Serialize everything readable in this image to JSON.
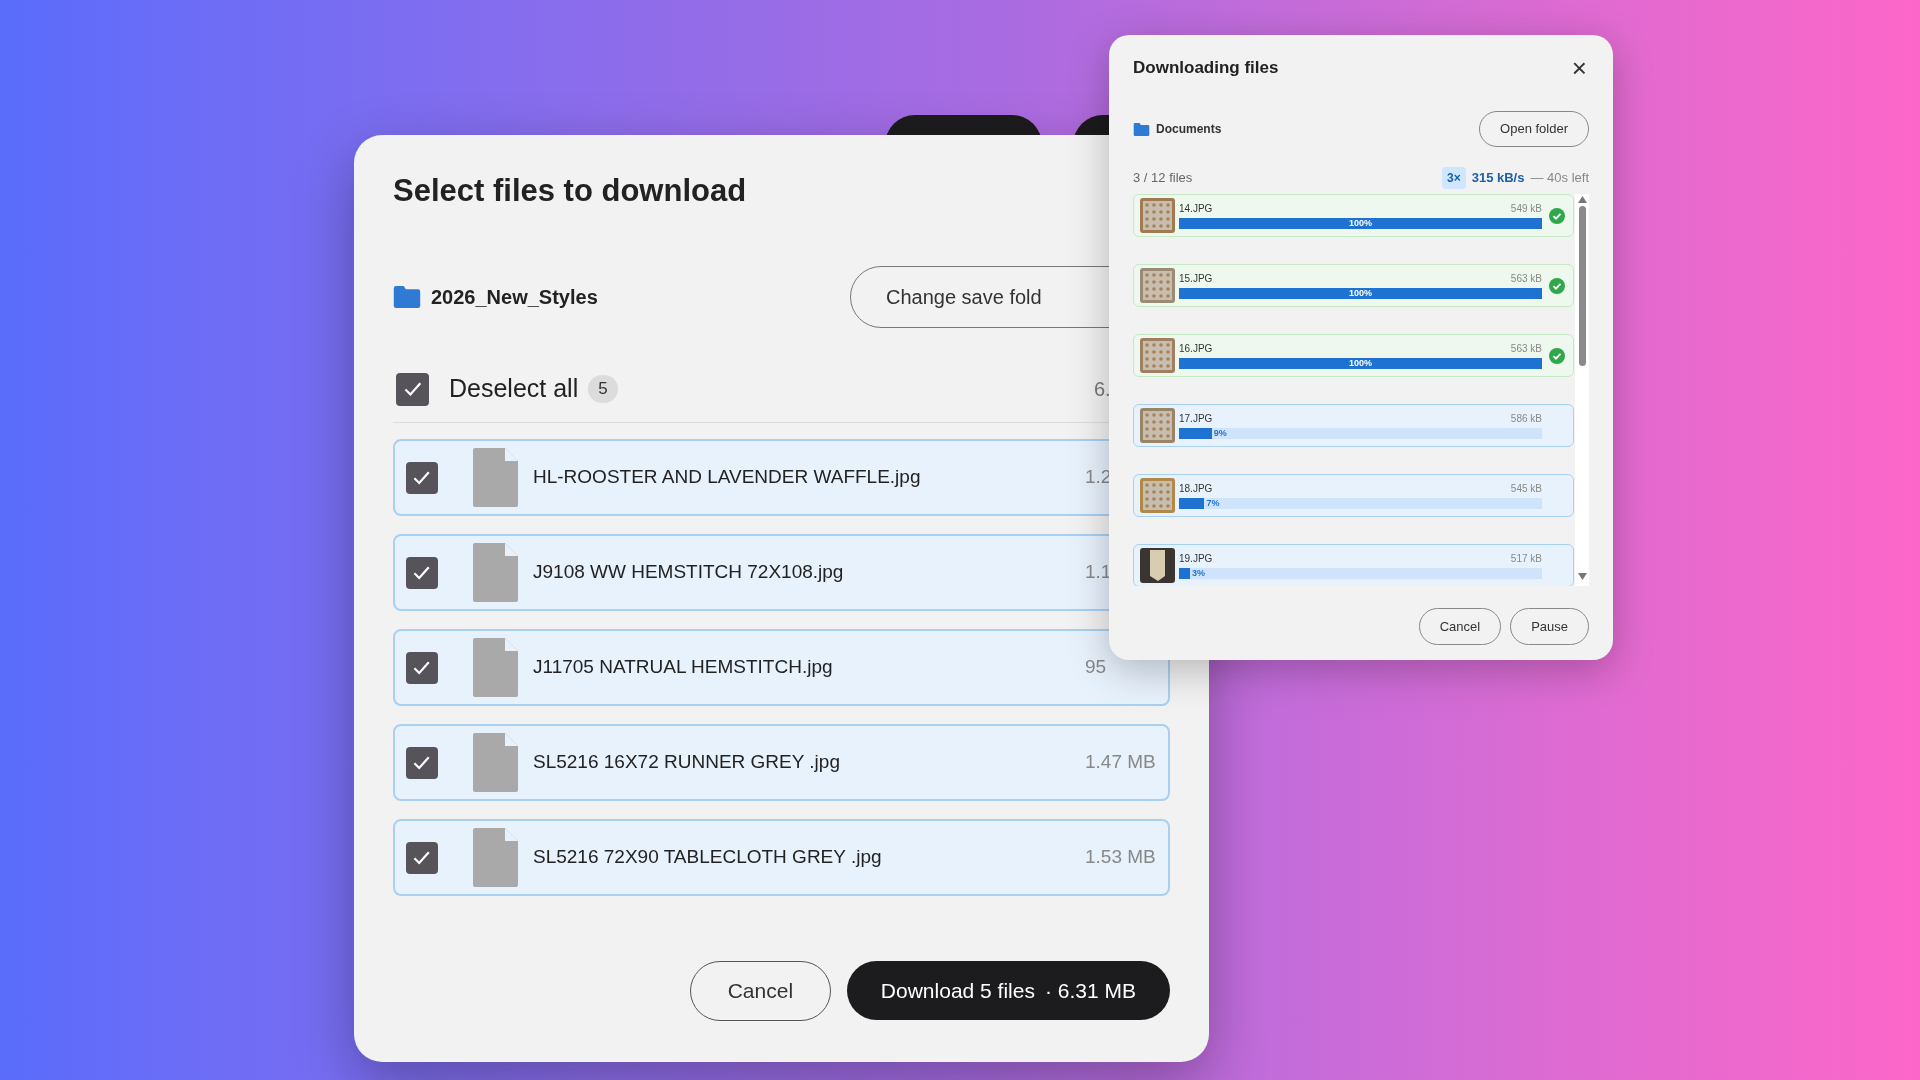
{
  "select_dialog": {
    "title": "Select files to download",
    "folder": "2026_New_Styles",
    "change_folder_button": "Change save fold",
    "select_all": {
      "label": "Deselect all",
      "checked": true,
      "count": "5",
      "total": "6."
    },
    "files": [
      {
        "name": "HL-ROOSTER AND LAVENDER WAFFLE.jpg",
        "size": "1.2",
        "checked": true
      },
      {
        "name": "J9108 WW HEMSTITCH 72X108.jpg",
        "size": "1.1",
        "checked": true
      },
      {
        "name": "J11705 NATRUAL HEMSTITCH.jpg",
        "size": "95",
        "checked": true
      },
      {
        "name": "SL5216 16X72 RUNNER GREY .jpg",
        "size": "1.47 MB",
        "checked": true
      },
      {
        "name": "SL5216 72X90 TABLECLOTH GREY .jpg",
        "size": "1.53 MB",
        "checked": true
      }
    ],
    "buttons": [
      {
        "label": "Cancel",
        "kind": "secondary"
      },
      {
        "label": "Download 5 files",
        "extra": "· 6.31 MB",
        "kind": "primary"
      }
    ]
  },
  "download_panel": {
    "title": "Downloading files",
    "close": "×",
    "folder": "Documents",
    "open_folder_button": "Open folder",
    "progress": "3 / 12 files",
    "parallel": "3×",
    "speed": "315 kB/s",
    "remaining": "— 40s left",
    "items": [
      {
        "name": "14.JPG",
        "size": "549 kB",
        "level": 1,
        "percent": "100%",
        "done": true
      },
      {
        "name": "15.JPG",
        "size": "563 kB",
        "level": 1,
        "percent": "100%",
        "done": true
      },
      {
        "name": "16.JPG",
        "size": "563 kB",
        "level": 1,
        "percent": "100%",
        "done": true
      },
      {
        "name": "17.JPG",
        "size": "586 kB",
        "level": 0.09,
        "percent": "9%",
        "done": false
      },
      {
        "name": "18.JPG",
        "size": "545 kB",
        "level": 0.07,
        "percent": "7%",
        "done": false
      },
      {
        "name": "19.JPG",
        "size": "517 kB",
        "level": 0.03,
        "percent": "3%",
        "done": false
      }
    ],
    "buttons": [
      "Cancel",
      "Pause"
    ]
  }
}
